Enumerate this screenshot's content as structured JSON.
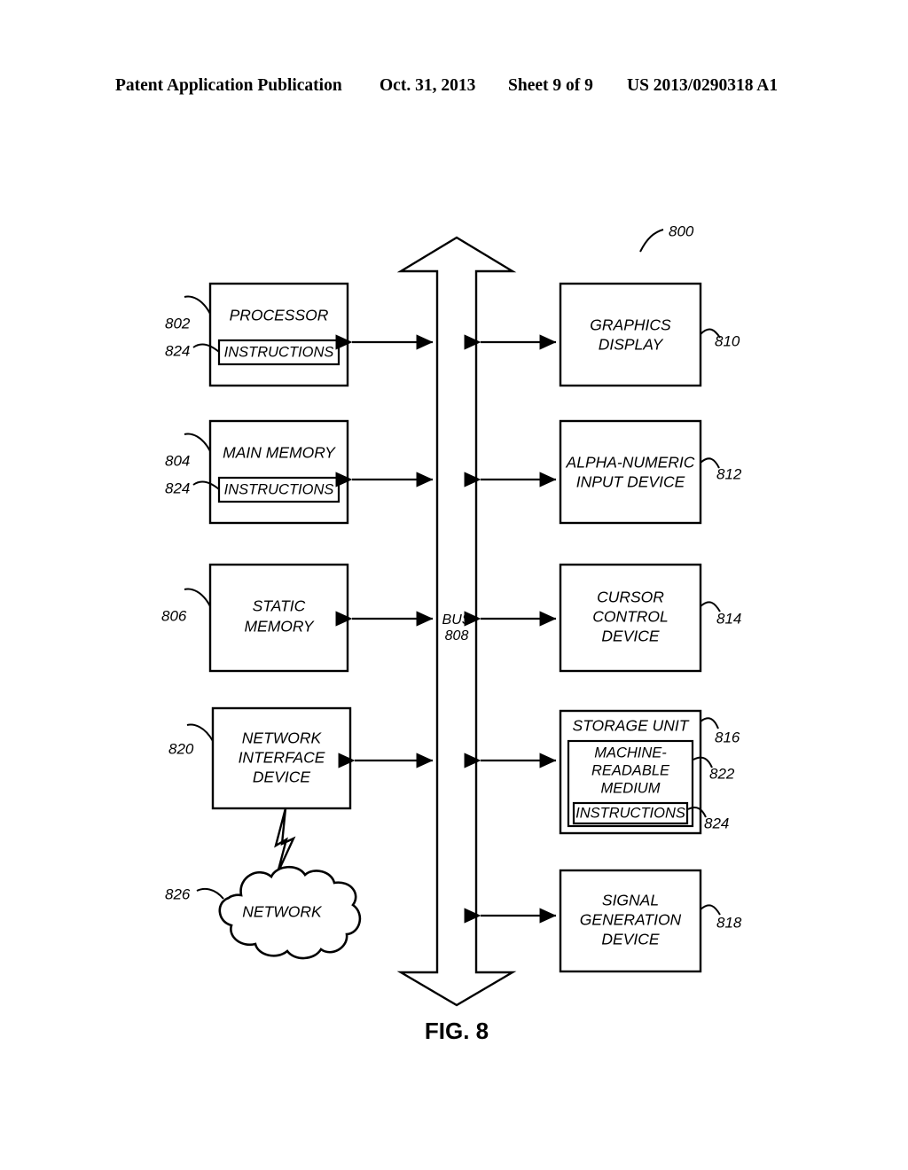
{
  "header": {
    "title": "Patent Application Publication",
    "date": "Oct. 31, 2013",
    "sheet": "Sheet 9 of 9",
    "publication_number": "US 2013/0290318 A1"
  },
  "figure": {
    "caption": "FIG. 8",
    "system_ref": "800",
    "bus": {
      "label": "BUS",
      "ref": "808"
    }
  },
  "blocks": {
    "processor": {
      "label": "PROCESSOR",
      "ref": "802"
    },
    "processor_instr": {
      "label": "INSTRUCTIONS",
      "ref": "824"
    },
    "main_memory": {
      "label": "MAIN MEMORY",
      "ref": "804"
    },
    "main_mem_instr": {
      "label": "INSTRUCTIONS",
      "ref": "824"
    },
    "static_memory": {
      "label_line1": "STATIC",
      "label_line2": "MEMORY",
      "ref": "806"
    },
    "network_interface": {
      "label_line1": "NETWORK",
      "label_line2": "INTERFACE",
      "label_line3": "DEVICE",
      "ref": "820"
    },
    "network": {
      "label": "NETWORK",
      "ref": "826"
    },
    "graphics_display": {
      "label_line1": "GRAPHICS",
      "label_line2": "DISPLAY",
      "ref": "810"
    },
    "alpha_input": {
      "label_line1": "ALPHA-NUMERIC",
      "label_line2": "INPUT DEVICE",
      "ref": "812"
    },
    "cursor_control": {
      "label_line1": "CURSOR",
      "label_line2": "CONTROL",
      "label_line3": "DEVICE",
      "ref": "814"
    },
    "storage_unit": {
      "label": "STORAGE UNIT",
      "ref": "816"
    },
    "machine_medium": {
      "label_line1": "MACHINE-",
      "label_line2": "READABLE",
      "label_line3": "MEDIUM",
      "ref": "822"
    },
    "storage_instr": {
      "label": "INSTRUCTIONS",
      "ref": "824"
    },
    "signal_gen": {
      "label_line1": "SIGNAL",
      "label_line2": "GENERATION",
      "label_line3": "DEVICE",
      "ref": "818"
    }
  },
  "colors": {
    "ink": "#000000",
    "paper": "#ffffff"
  }
}
